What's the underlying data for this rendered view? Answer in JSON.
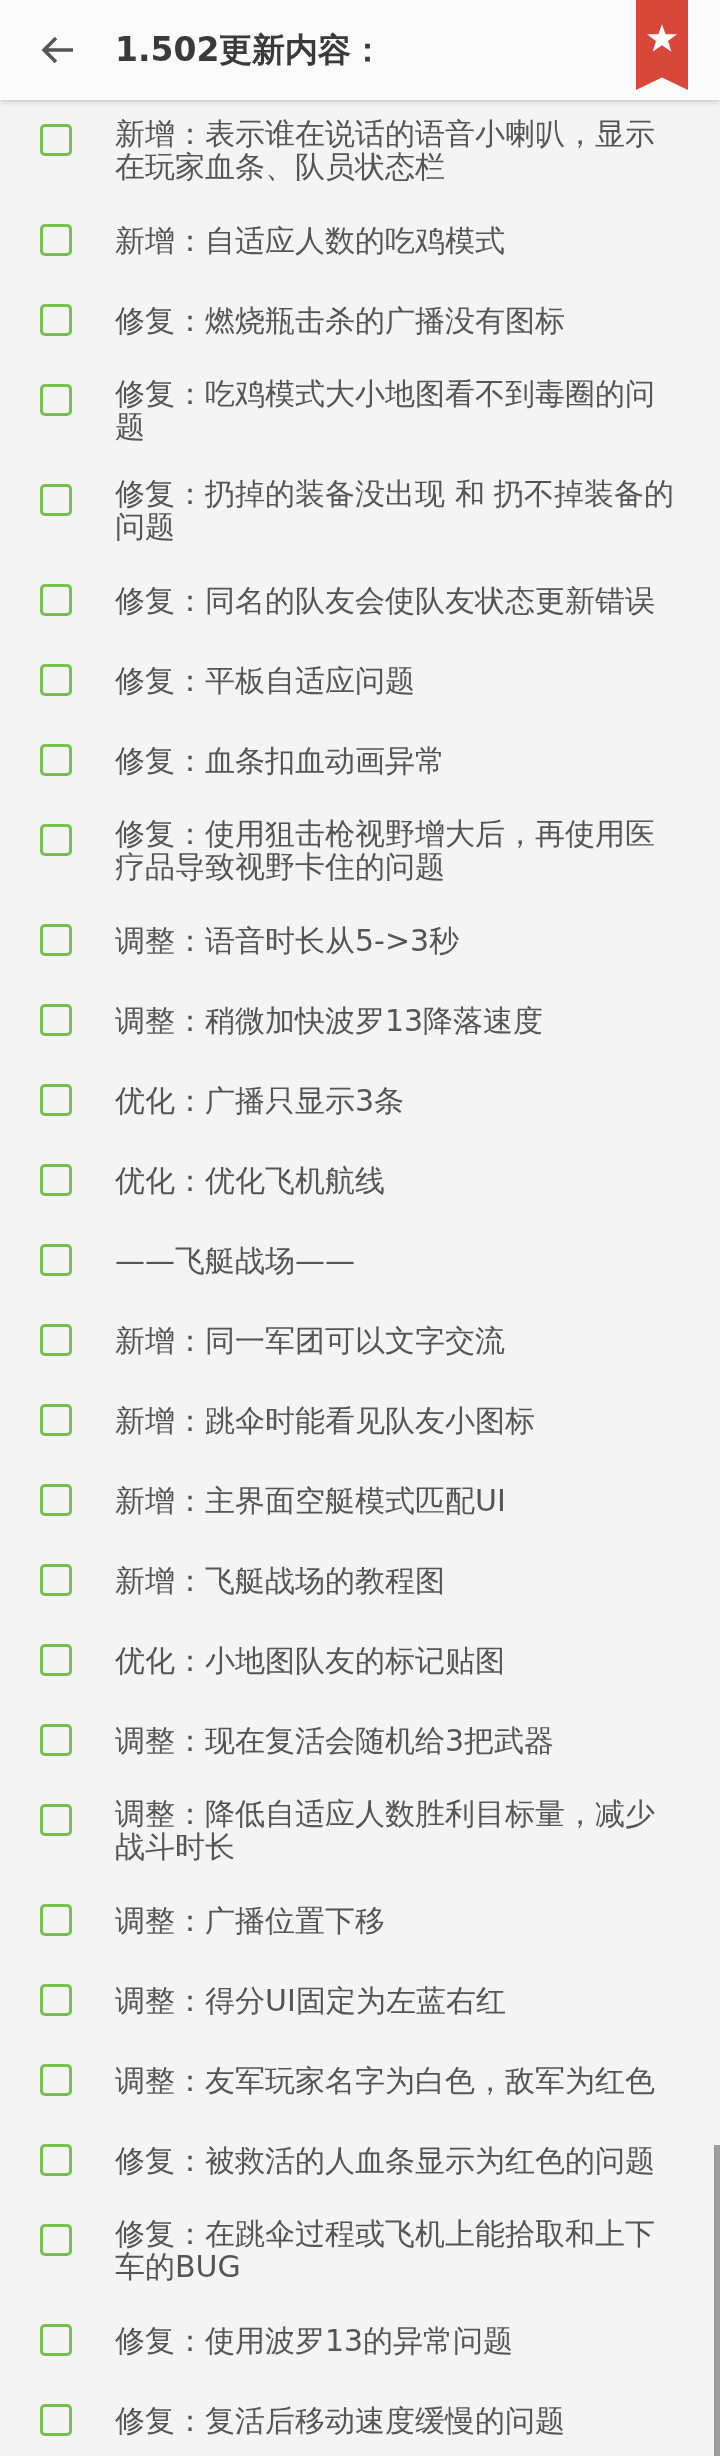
{
  "header": {
    "title": "1.502更新内容："
  },
  "items": [
    {
      "text": "新增：表示谁在说话的语音小喇叭，显示在玩家血条、队员状态栏",
      "checked": false
    },
    {
      "text": "新增：自适应人数的吃鸡模式",
      "checked": false
    },
    {
      "text": "修复：燃烧瓶击杀的广播没有图标",
      "checked": false
    },
    {
      "text": "修复：吃鸡模式大小地图看不到毒圈的问题",
      "checked": false
    },
    {
      "text": "修复：扔掉的装备没出现 和 扔不掉装备的问题",
      "checked": false
    },
    {
      "text": "修复：同名的队友会使队友状态更新错误",
      "checked": false
    },
    {
      "text": "修复：平板自适应问题",
      "checked": false
    },
    {
      "text": "修复：血条扣血动画异常",
      "checked": false
    },
    {
      "text": "修复：使用狙击枪视野增大后，再使用医疗品导致视野卡住的问题",
      "checked": false
    },
    {
      "text": "调整：语音时长从5->3秒",
      "checked": false
    },
    {
      "text": "调整：稍微加快波罗13降落速度",
      "checked": false
    },
    {
      "text": "优化：广播只显示3条",
      "checked": false
    },
    {
      "text": "优化：优化飞机航线",
      "checked": false
    },
    {
      "text": "——飞艇战场——",
      "checked": false
    },
    {
      "text": "新增：同一军团可以文字交流",
      "checked": false
    },
    {
      "text": "新增：跳伞时能看见队友小图标",
      "checked": false
    },
    {
      "text": "新增：主界面空艇模式匹配UI",
      "checked": false
    },
    {
      "text": "新增：飞艇战场的教程图",
      "checked": false
    },
    {
      "text": "优化：小地图队友的标记贴图",
      "checked": false
    },
    {
      "text": "调整：现在复活会随机给3把武器",
      "checked": false
    },
    {
      "text": "调整：降低自适应人数胜利目标量，减少战斗时长",
      "checked": false
    },
    {
      "text": "调整：广播位置下移",
      "checked": false
    },
    {
      "text": "调整：得分UI固定为左蓝右红",
      "checked": false
    },
    {
      "text": "调整：友军玩家名字为白色，敌军为红色",
      "checked": false
    },
    {
      "text": "修复：被救活的人血条显示为红色的问题",
      "checked": false
    },
    {
      "text": "修复：在跳伞过程或飞机上能拾取和上下车的BUG",
      "checked": false
    },
    {
      "text": "修复：使用波罗13的异常问题",
      "checked": false
    },
    {
      "text": "修复：复活后移动速度缓慢的问题",
      "checked": false
    }
  ]
}
